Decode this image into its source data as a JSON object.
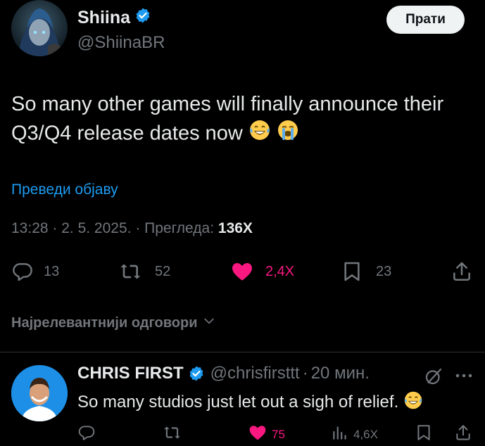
{
  "tweet": {
    "author_name": "Shiina",
    "author_handle": "@ShiinaBR",
    "follow_label": "Прати",
    "text": "So many other games will finally announce their Q3/Q4 release dates now",
    "translate_label": "Преведи објаву",
    "time": "13:28",
    "date": "2. 5. 2025.",
    "views_label": "Прегледа:",
    "views_count": "136X",
    "stats": {
      "replies": "13",
      "reposts": "52",
      "likes": "2,4X",
      "bookmarks": "23"
    },
    "icons": [
      "verified-icon",
      "laughing-emoji",
      "crying-emoji",
      "reply-icon",
      "repost-icon",
      "like-icon",
      "bookmark-icon",
      "share-icon"
    ]
  },
  "replies_section": {
    "sort_label": "Најрелевантнији одговори"
  },
  "reply": {
    "author_name": "CHRIS FIRST",
    "author_handle": "@chrisfirsttt",
    "time": "20 мин.",
    "text": "So many studios just let out a sigh of relief.",
    "stats": {
      "likes": "75",
      "views": "4,6X"
    }
  },
  "colors": {
    "background": "#000000",
    "text": "#e7e9ea",
    "muted": "#71767b",
    "accent": "#1d9bf0",
    "like": "#f91880"
  }
}
